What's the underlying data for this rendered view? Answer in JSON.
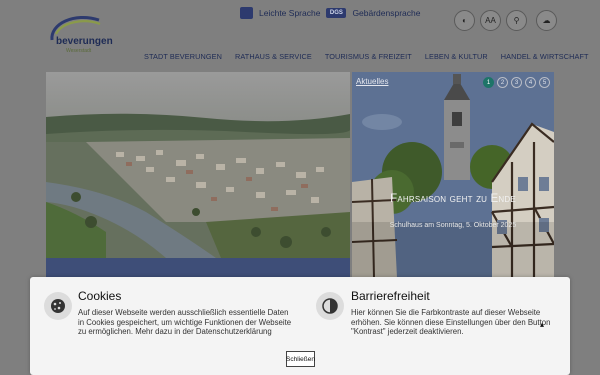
{
  "header": {
    "logo": {
      "name": "beverungen",
      "tagline": "Weserstadt"
    },
    "easy_language": "Leichte Sprache",
    "sign_language": "Gebärdensprache",
    "sign_language_badge": "DGS",
    "tools": [
      {
        "icon": "contrast-icon",
        "label": "◐"
      },
      {
        "icon": "font-size-icon",
        "label": "AA"
      },
      {
        "icon": "search-icon",
        "label": "⚲"
      },
      {
        "icon": "weather-icon",
        "label": "☁"
      }
    ]
  },
  "nav": [
    "STADT BEVERUNGEN",
    "RATHAUS & SERVICE",
    "TOURISMUS & FREIZEIT",
    "LEBEN & KULTUR",
    "HANDEL & WIRTSCHAFT"
  ],
  "slider": {
    "section_label": "Aktuelles",
    "title": "Fahrsaison geht zu Ende",
    "subtitle": "Schulhaus am Sonntag, 5. Oktober 2025",
    "dots": [
      "1",
      "2",
      "3",
      "4",
      "5"
    ],
    "active_dot": 0
  },
  "cookies": {
    "title": "Cookies",
    "text": "Auf dieser Webseite werden ausschließlich essentielle Daten in Cookies gespeichert, um wichtige Funktionen der Webseite zu ermöglichen. Mehr dazu in der Datenschutzerklärung"
  },
  "accessibility": {
    "title": "Barrierefreiheit",
    "text": "Hier können Sie die Farbkontraste auf dieser Webseite erhöhen. Sie können diese Einstellungen über den Button \"Kontrast\" jederzeit deaktivieren."
  },
  "close_label": "Schließen",
  "colors": {
    "brand_navy": "#1e2b55",
    "accent_teal": "#1e7468",
    "overlay_bg": "#f4f4f4"
  }
}
